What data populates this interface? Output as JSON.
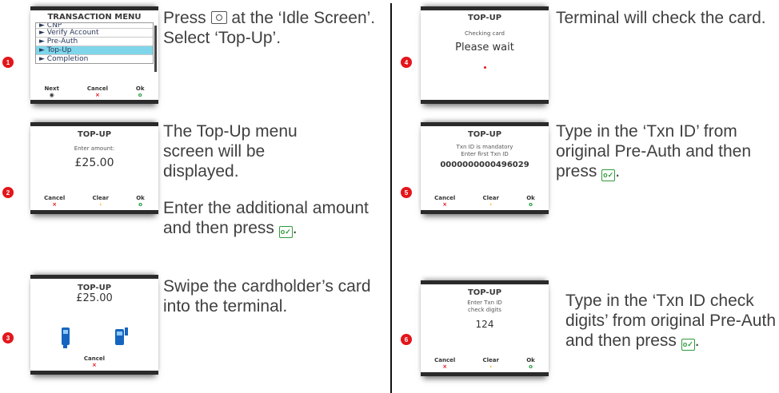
{
  "steps": [
    {
      "num": "1",
      "text_before": "Press ",
      "text_after": " at the ‘Idle Screen’. Select ‘Top-Up’.",
      "screen": {
        "title": "TRANSACTION MENU",
        "items": [
          "► CNP",
          "► Verify Account",
          "► Pre-Auth",
          "► Top-Up",
          "► Completion"
        ],
        "keys": [
          {
            "label": "Next",
            "sym": "◉"
          },
          {
            "label": "Cancel",
            "sym": "×"
          },
          {
            "label": "Ok",
            "sym": "o"
          }
        ]
      }
    },
    {
      "num": "2",
      "text": "The Top-Up menu screen will be displayed.",
      "text2_before": "Enter the additional amount and then press ",
      "text2_after": ".",
      "screen": {
        "title": "TOP-UP",
        "prompt": "Enter amount:",
        "amount": "£25.00",
        "keys": [
          {
            "label": "Cancel",
            "sym": "×"
          },
          {
            "label": "Clear",
            "sym": "‹"
          },
          {
            "label": "Ok",
            "sym": "o"
          }
        ]
      }
    },
    {
      "num": "3",
      "text": "Swipe the cardholder’s card into the terminal.",
      "screen": {
        "title": "TOP-UP",
        "amount": "£25.00",
        "keys": [
          {
            "label": "Cancel",
            "sym": "×"
          }
        ]
      }
    },
    {
      "num": "4",
      "text": "Terminal will check the card.",
      "screen": {
        "title": "TOP-UP",
        "line1": "Checking card",
        "line2": "Please wait"
      }
    },
    {
      "num": "5",
      "text_before": "Type in the ‘Txn ID’ from original Pre-Auth and then press ",
      "text_after": ".",
      "screen": {
        "title": "TOP-UP",
        "line1": "Txn ID is mandatory",
        "line2": "Enter first Txn ID",
        "value": "0000000000496029",
        "keys": [
          {
            "label": "Cancel",
            "sym": "×"
          },
          {
            "label": "Clear",
            "sym": "‹"
          },
          {
            "label": "Ok",
            "sym": "o"
          }
        ]
      }
    },
    {
      "num": "6",
      "text_before": "Type in the ‘Txn ID check digits’ from original Pre-Auth and then press ",
      "text_after": ".",
      "screen": {
        "title": "TOP-UP",
        "line1": "Enter Txn ID",
        "line2": "check digits",
        "value": "124",
        "keys": [
          {
            "label": "Cancel",
            "sym": "×"
          },
          {
            "label": "Clear",
            "sym": "‹"
          },
          {
            "label": "Ok",
            "sym": "o"
          }
        ]
      }
    }
  ],
  "colors": {
    "badge": "#e3161b",
    "highlight": "#7fd6ea",
    "ok": "#1a9a3a",
    "cancel": "#e3161b",
    "clear": "#f0a500",
    "terminal": "#1565c0"
  }
}
